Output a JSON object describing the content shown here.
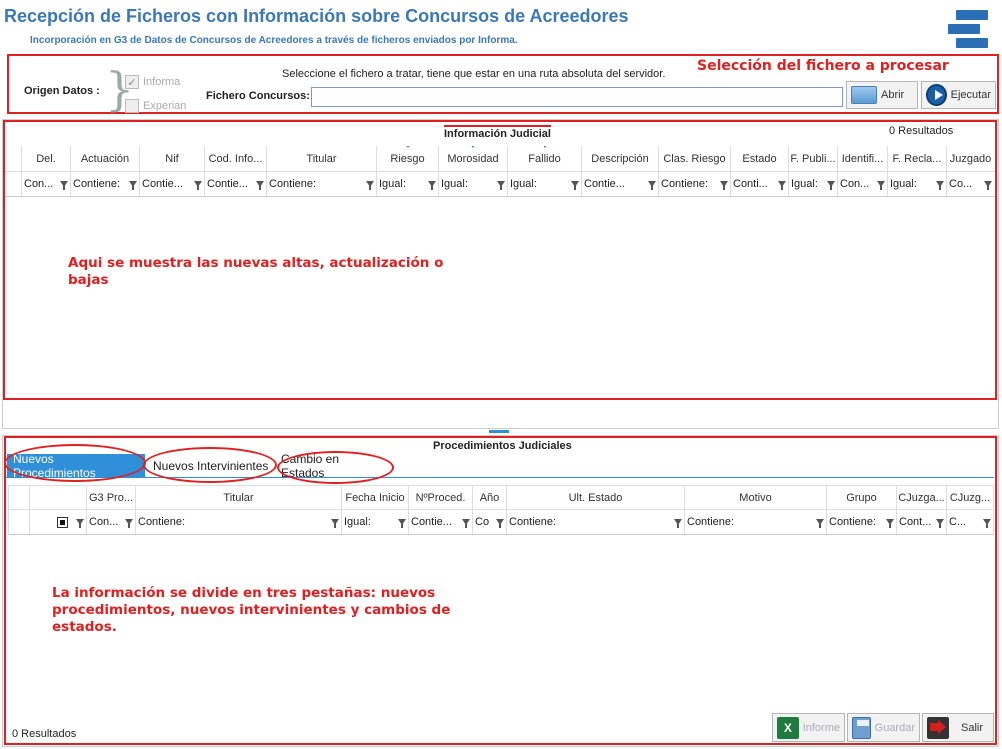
{
  "header": {
    "title": "Recepción de Ficheros con Información sobre Concursos de Acreedores",
    "subtitle": "Incorporación en G3 de Datos de Concursos de Acreedores a través de ficheros enviados por Informa."
  },
  "source": {
    "label": "Origen Datos :",
    "options": [
      {
        "label": "Informa",
        "checked": true
      },
      {
        "label": "Experian",
        "checked": false
      }
    ]
  },
  "file": {
    "instruction": "Seleccione el fichero a tratar, tiene que estar en una ruta absoluta del servidor.",
    "label": "Fichero Concursos:",
    "value": "",
    "open_button": "Abrir",
    "run_button": "Ejecutar"
  },
  "annotations": {
    "file_section": "Selección del fichero a procesar",
    "judicial_info": "Aqui se muestra las nuevas altas, actualización o bajas",
    "tabs_info": "La información se divide en tres pestañas: nuevos procedimientos, nuevos intervinientes y cambios de estados."
  },
  "judicial": {
    "title": "Información Judicial",
    "results": "0 Resultados",
    "columns": [
      "Del.",
      "Actuación",
      "Nif",
      "Cod. Info...",
      "Titular",
      "Riesgo",
      "Morosidad",
      "Fallido",
      "Descripción",
      "Clas. Riesgo",
      "Estado",
      "F. Publi...",
      "Identifi...",
      "F. Recla...",
      "Juzgado"
    ],
    "filters": [
      "Con...",
      "Contiene:",
      "Contie...",
      "Contie...",
      "Contiene:",
      "Igual:",
      "Igual:",
      "Igual:",
      "Contie...",
      "Contiene:",
      "Conti...",
      "Igual:",
      "Con...",
      "Igual:",
      "Co..."
    ]
  },
  "procedures": {
    "title": "Procedimientos Judiciales",
    "tabs": [
      "Nuevos Procedimientos",
      "Nuevos Intervinientes",
      "Cambio en Estados"
    ],
    "active_tab": 0,
    "columns": [
      "",
      "G3 Pro...",
      "Titular",
      "Fecha Inicio",
      "NºProced.",
      "Año",
      "Ult. Estado",
      "Motivo",
      "Grupo",
      "CJuzga...",
      "CJuzg..."
    ],
    "filters": [
      "",
      "Con...",
      "Contiene:",
      "Igual:",
      "Contie...",
      "Co",
      "Contiene:",
      "Contiene:",
      "Contiene:",
      "Cont...",
      "C..."
    ],
    "results": "0 Resultados"
  },
  "footer": {
    "report_button": "Informe",
    "save_button": "Guardar",
    "exit_button": "Salir"
  },
  "colors": {
    "accent": "#3a78b8",
    "annotation_red": "#e02020",
    "active_tab": "#2f8fd8"
  }
}
